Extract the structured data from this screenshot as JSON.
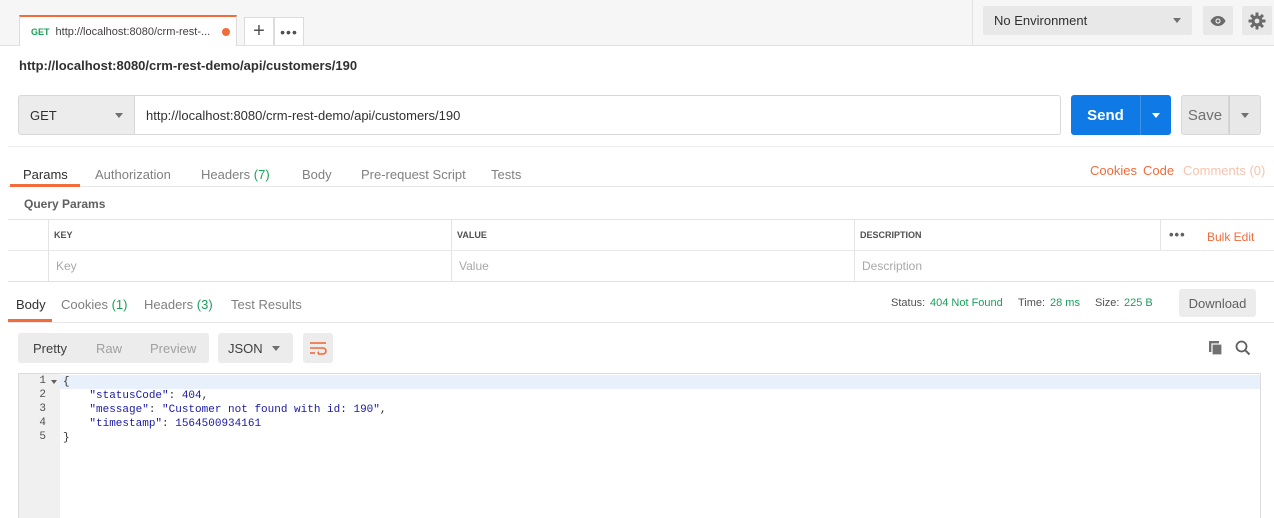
{
  "tab": {
    "method": "GET",
    "title": "http://localhost:8080/crm-rest-..."
  },
  "environment": {
    "selected": "No Environment"
  },
  "request": {
    "title": "http://localhost:8080/crm-rest-demo/api/customers/190",
    "method": "GET",
    "url": "http://localhost:8080/crm-rest-demo/api/customers/190",
    "send_label": "Send",
    "save_label": "Save"
  },
  "request_tabs": {
    "params": "Params",
    "authorization": "Authorization",
    "headers": "Headers",
    "headers_count": "(7)",
    "body": "Body",
    "prerequest": "Pre-request Script",
    "tests": "Tests",
    "cookies_link": "Cookies",
    "code_link": "Code",
    "comments_link": "Comments (0)"
  },
  "query_params": {
    "title": "Query Params",
    "columns": [
      "KEY",
      "VALUE",
      "DESCRIPTION"
    ],
    "placeholders": [
      "Key",
      "Value",
      "Description"
    ],
    "bulk_edit": "Bulk Edit"
  },
  "response_tabs": {
    "body": "Body",
    "cookies": "Cookies",
    "cookies_count": "(1)",
    "headers": "Headers",
    "headers_count": "(3)",
    "test_results": "Test Results"
  },
  "response_meta": {
    "status_label": "Status:",
    "status_value": "404 Not Found",
    "time_label": "Time:",
    "time_value": "28 ms",
    "size_label": "Size:",
    "size_value": "225 B",
    "download_label": "Download"
  },
  "response_toolbar": {
    "pretty": "Pretty",
    "raw": "Raw",
    "preview": "Preview",
    "format": "JSON"
  },
  "response_body": {
    "line_numbers": [
      "1",
      "2",
      "3",
      "4",
      "5"
    ],
    "open_brace": "{",
    "close_brace": "}",
    "fields": [
      {
        "key": "\"statusCode\"",
        "value": "404",
        "trailing": ","
      },
      {
        "key": "\"message\"",
        "value": "\"Customer not found with id: 190\"",
        "trailing": ","
      },
      {
        "key": "\"timestamp\"",
        "value": "1564500934161",
        "trailing": ""
      }
    ]
  },
  "colors": {
    "accent": "#f26b3a",
    "send_blue": "#0f7ae5",
    "status_green": "#1a9f5b"
  }
}
